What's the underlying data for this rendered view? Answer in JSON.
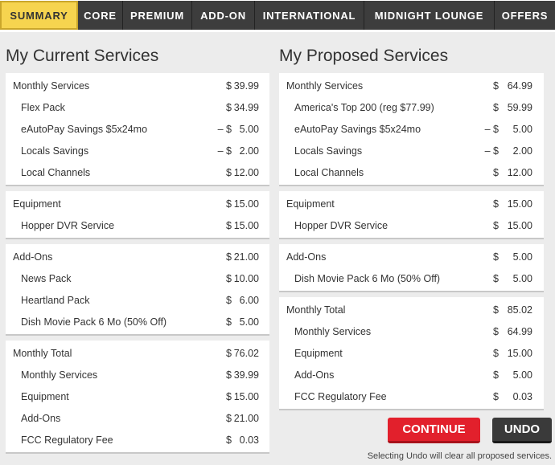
{
  "tabs": [
    {
      "label": "SUMMARY",
      "active": true
    },
    {
      "label": "CORE",
      "active": false
    },
    {
      "label": "PREMIUM",
      "active": false
    },
    {
      "label": "ADD-ON",
      "active": false
    },
    {
      "label": "INTERNATIONAL",
      "active": false
    },
    {
      "label": "MIDNIGHT LOUNGE",
      "active": false
    },
    {
      "label": "OFFERS",
      "active": false
    }
  ],
  "current": {
    "title": "My Current Services",
    "sections": [
      {
        "rows": [
          {
            "label": "Monthly Services",
            "cur": "$",
            "amt": "39.99",
            "sub": false
          },
          {
            "label": "Flex Pack",
            "cur": "$",
            "amt": "34.99",
            "sub": true
          },
          {
            "label": "eAutoPay Savings $5x24mo",
            "cur": "– $",
            "amt": "5.00",
            "sub": true
          },
          {
            "label": "Locals Savings",
            "cur": "– $",
            "amt": "2.00",
            "sub": true
          },
          {
            "label": "Local Channels",
            "cur": "$",
            "amt": "12.00",
            "sub": true
          }
        ]
      },
      {
        "rows": [
          {
            "label": "Equipment",
            "cur": "$",
            "amt": "15.00",
            "sub": false
          },
          {
            "label": "Hopper DVR Service",
            "cur": "$",
            "amt": "15.00",
            "sub": true
          }
        ]
      },
      {
        "rows": [
          {
            "label": "Add-Ons",
            "cur": "$",
            "amt": "21.00",
            "sub": false
          },
          {
            "label": "News Pack",
            "cur": "$",
            "amt": "10.00",
            "sub": true
          },
          {
            "label": "Heartland Pack",
            "cur": "$",
            "amt": "6.00",
            "sub": true
          },
          {
            "label": "Dish Movie Pack 6 Mo (50% Off)",
            "cur": "$",
            "amt": "5.00",
            "sub": true
          }
        ]
      },
      {
        "rows": [
          {
            "label": "Monthly Total",
            "cur": "$",
            "amt": "76.02",
            "sub": false
          },
          {
            "label": "Monthly Services",
            "cur": "$",
            "amt": "39.99",
            "sub": true
          },
          {
            "label": "Equipment",
            "cur": "$",
            "amt": "15.00",
            "sub": true
          },
          {
            "label": "Add-Ons",
            "cur": "$",
            "amt": "21.00",
            "sub": true
          },
          {
            "label": "FCC Regulatory Fee",
            "cur": "$",
            "amt": "0.03",
            "sub": true
          }
        ]
      }
    ]
  },
  "proposed": {
    "title": "My Proposed Services",
    "sections": [
      {
        "rows": [
          {
            "label": "Monthly Services",
            "cur": "$",
            "amt": "64.99",
            "sub": false
          },
          {
            "label": "America's Top 200 (reg $77.99)",
            "cur": "$",
            "amt": "59.99",
            "sub": true
          },
          {
            "label": "eAutoPay Savings $5x24mo",
            "cur": "– $",
            "amt": "5.00",
            "sub": true
          },
          {
            "label": "Locals Savings",
            "cur": "– $",
            "amt": "2.00",
            "sub": true
          },
          {
            "label": "Local Channels",
            "cur": "$",
            "amt": "12.00",
            "sub": true
          }
        ]
      },
      {
        "rows": [
          {
            "label": "Equipment",
            "cur": "$",
            "amt": "15.00",
            "sub": false
          },
          {
            "label": "Hopper DVR Service",
            "cur": "$",
            "amt": "15.00",
            "sub": true
          }
        ]
      },
      {
        "rows": [
          {
            "label": "Add-Ons",
            "cur": "$",
            "amt": "5.00",
            "sub": false
          },
          {
            "label": "Dish Movie Pack 6 Mo (50% Off)",
            "cur": "$",
            "amt": "5.00",
            "sub": true
          }
        ]
      },
      {
        "rows": [
          {
            "label": "Monthly Total",
            "cur": "$",
            "amt": "85.02",
            "sub": false
          },
          {
            "label": "Monthly Services",
            "cur": "$",
            "amt": "64.99",
            "sub": true
          },
          {
            "label": "Equipment",
            "cur": "$",
            "amt": "15.00",
            "sub": true
          },
          {
            "label": "Add-Ons",
            "cur": "$",
            "amt": "5.00",
            "sub": true
          },
          {
            "label": "FCC Regulatory Fee",
            "cur": "$",
            "amt": "0.03",
            "sub": true
          }
        ]
      }
    ]
  },
  "actions": {
    "continue_label": "CONTINUE",
    "undo_label": "UNDO",
    "undo_note": "Selecting Undo will clear all proposed services."
  },
  "colors": {
    "active_tab": "#f6d44f",
    "tab_bg": "#3d3d3d",
    "continue": "#e2202c",
    "undo": "#3a3a3a"
  }
}
